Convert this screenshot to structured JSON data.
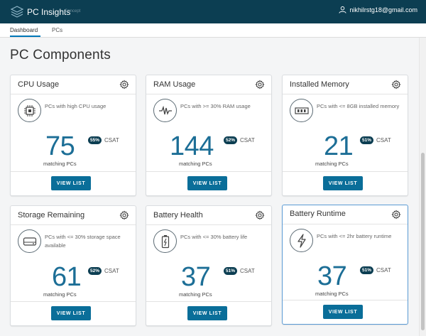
{
  "header": {
    "app_name": "PC Insights",
    "app_tag": "Concept",
    "user_email": "nikhilrstg18@gmail.com"
  },
  "nav": {
    "tabs": [
      {
        "label": "Dashboard",
        "active": true
      },
      {
        "label": "PCs",
        "active": false
      }
    ]
  },
  "page": {
    "title": "PC Components"
  },
  "colors": {
    "accent": "#0a6e99",
    "header_bg": "#0c3e52",
    "number": "#1c6e96"
  },
  "cards": [
    {
      "title": "CPU Usage",
      "icon": "cpu-icon",
      "description": "PCs with high CPU usage",
      "count": "75",
      "count_label": "matching PCs",
      "csat_percent": "55%",
      "csat_label": "CSAT",
      "button_label": "VIEW LIST"
    },
    {
      "title": "RAM Usage",
      "icon": "ram-activity-icon",
      "description": "PCs with >= 30% RAM usage",
      "count": "144",
      "count_label": "matching PCs",
      "csat_percent": "52%",
      "csat_label": "CSAT",
      "button_label": "VIEW LIST"
    },
    {
      "title": "Installed Memory",
      "icon": "memory-module-icon",
      "description": "PCs with <= 8GB installed memory",
      "count": "21",
      "count_label": "matching PCs",
      "csat_percent": "51%",
      "csat_label": "CSAT",
      "button_label": "VIEW LIST"
    },
    {
      "title": "Storage Remaining",
      "icon": "storage-drive-icon",
      "description": "PCs with <= 30% storage space available",
      "count": "61",
      "count_label": "matching PCs",
      "csat_percent": "52%",
      "csat_label": "CSAT",
      "button_label": "VIEW LIST"
    },
    {
      "title": "Battery Health",
      "icon": "battery-icon",
      "description": "PCs with <= 30% battery life",
      "count": "37",
      "count_label": "matching PCs",
      "csat_percent": "51%",
      "csat_label": "CSAT",
      "button_label": "VIEW LIST"
    },
    {
      "title": "Battery Runtime",
      "icon": "lightning-bolt-icon",
      "description": "PCs with <= 2hr battery runtime",
      "count": "37",
      "count_label": "matching PCs",
      "csat_percent": "51%",
      "csat_label": "CSAT",
      "button_label": "VIEW LIST"
    }
  ]
}
